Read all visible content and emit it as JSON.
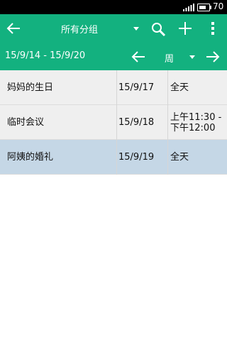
{
  "status_bar": {
    "battery_text": "70",
    "icons": [
      "signal-icon",
      "battery-icon"
    ]
  },
  "action_bar": {
    "group_title": "所有分组",
    "icons": [
      "back-arrow-icon",
      "dropdown-caret-icon",
      "search-icon",
      "add-icon",
      "overflow-menu-icon"
    ]
  },
  "range_bar": {
    "range_text": "15/9/14 - 15/9/20",
    "view_label": "周",
    "icons": [
      "prev-arrow-icon",
      "dropdown-caret-icon",
      "next-arrow-icon"
    ]
  },
  "events": [
    {
      "title": "妈妈的生日",
      "date": "15/9/17",
      "time": "全天"
    },
    {
      "title": "临时会议",
      "date": "15/9/18",
      "time": "上午11:30 -\n下午12:00"
    },
    {
      "title": "阿姨的婚礼",
      "date": "15/9/19",
      "time": "全天"
    }
  ],
  "colors": {
    "accent": "#13b17f",
    "row_bg": "#efefef",
    "selected_row_bg": "#c5d7e6",
    "status_bar": "#000000"
  }
}
